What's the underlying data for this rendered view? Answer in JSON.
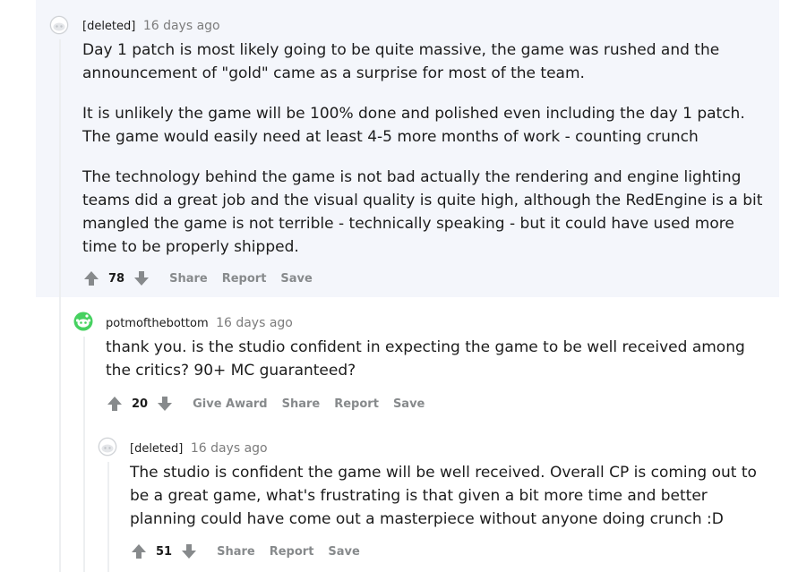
{
  "comments": [
    {
      "author": "[deleted]",
      "time": "16 days ago",
      "paragraphs": [
        "Day 1 patch is most likely going to be quite massive, the game was rushed and the announcement of \"gold\" came as a surprise for most of the team.",
        "It is unlikely the game will be 100% done and polished even including the day 1 patch. The game would easily need at least 4-5 more months of work - counting crunch",
        "The technology behind the game is not bad actually the rendering and engine lighting teams did a great job and the visual quality is quite high, although the RedEngine is a bit mangled the game is not terrible - technically speaking - but it could have used more time to be properly shipped."
      ],
      "score": "78",
      "actions": [
        "Share",
        "Report",
        "Save"
      ]
    },
    {
      "author": "potmofthebottom",
      "time": "16 days ago",
      "paragraphs": [
        "thank you. is the studio confident in expecting the game to be well received among the critics? 90+ MC guaranteed?"
      ],
      "score": "20",
      "actions": [
        "Give Award",
        "Share",
        "Report",
        "Save"
      ]
    },
    {
      "author": "[deleted]",
      "time": "16 days ago",
      "paragraphs": [
        "The studio is confident the game will be well received. Overall CP is coming out to be a great game, what's frustrating is that given a bit more time and better planning could have come out a masterpiece without anyone doing crunch :D"
      ],
      "score": "51",
      "actions": [
        "Share",
        "Report",
        "Save"
      ]
    }
  ],
  "colors": {
    "highlight": "#f4f6fb",
    "rail": "#edeff1",
    "muted": "#7c7c7c",
    "action": "#878a8c"
  },
  "icons": {
    "upvote": "arrow-up-icon",
    "downvote": "arrow-down-icon",
    "deleted_avatar": "snoo-gray-avatar",
    "user_avatar": "snoo-green-avatar"
  }
}
